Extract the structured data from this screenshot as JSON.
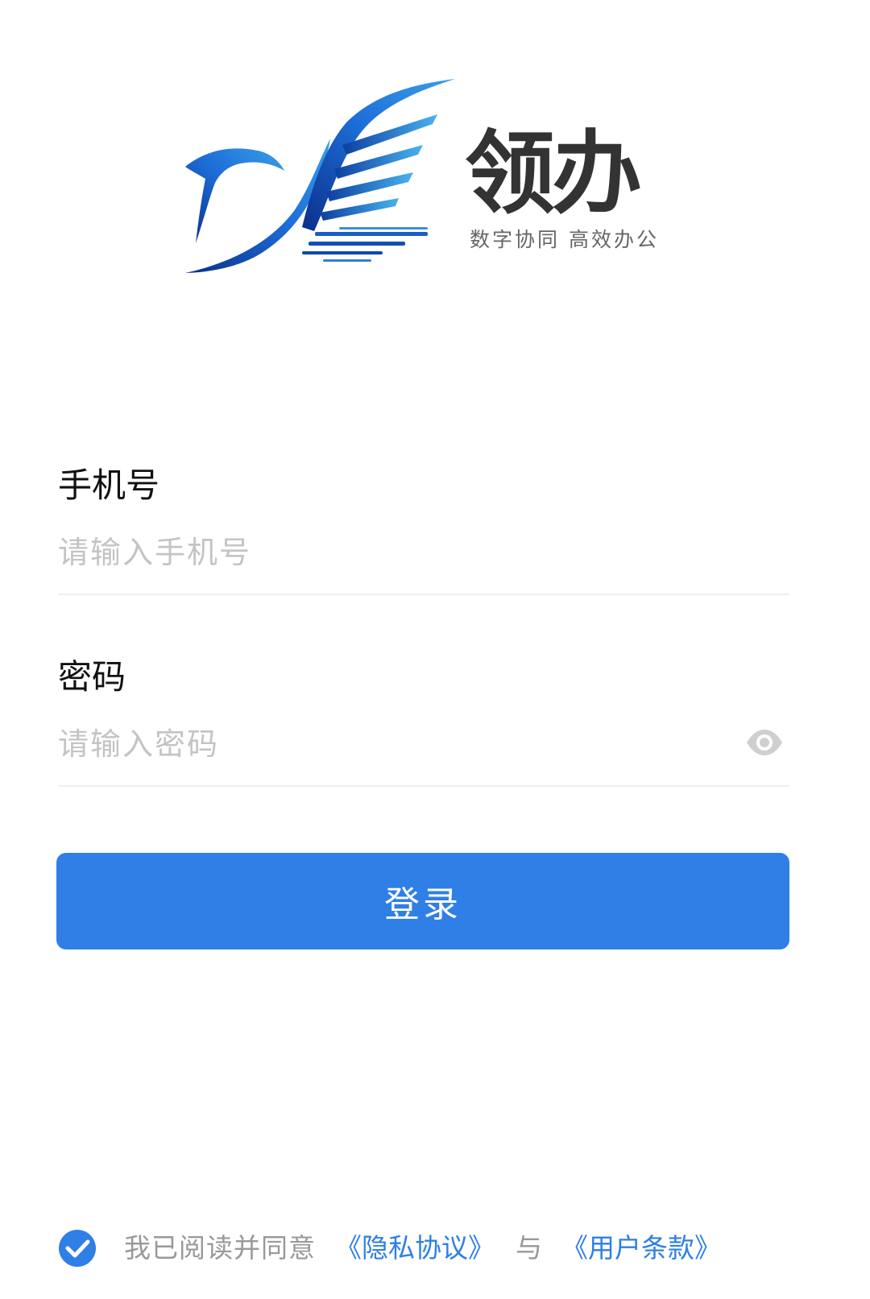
{
  "brand": {
    "name": "领办",
    "tagline": "数字协同 高效办公",
    "logo_icon": "bird-wing-logo",
    "primary_color": "#2f7fe6",
    "logo_gradient": [
      "#0a2f8c",
      "#1e6fd9",
      "#3aa0e8"
    ]
  },
  "form": {
    "phone": {
      "label": "手机号",
      "placeholder": "请输入手机号",
      "value": ""
    },
    "password": {
      "label": "密码",
      "placeholder": "请输入密码",
      "value": "",
      "toggle_icon": "eye-icon"
    },
    "submit_label": "登录"
  },
  "agreement": {
    "checked": true,
    "check_icon": "check-circle-icon",
    "text": "我已阅读并同意",
    "privacy_link": "《隐私协议》",
    "and_text": "与",
    "terms_link": "《用户条款》"
  }
}
